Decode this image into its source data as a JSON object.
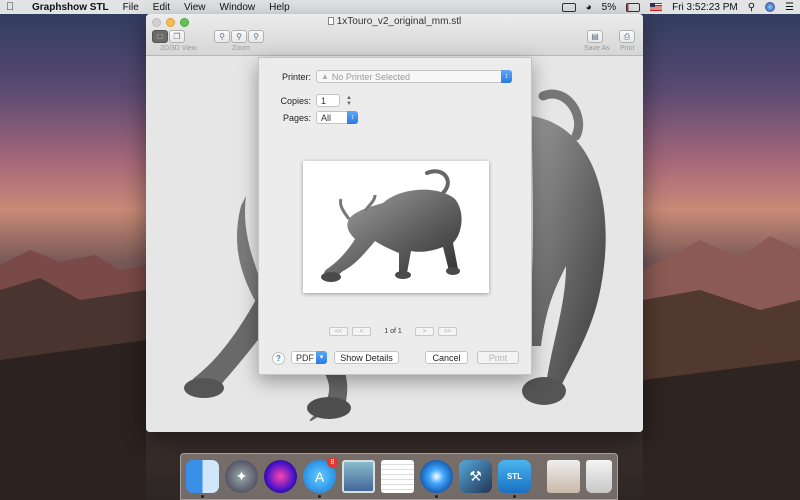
{
  "menubar": {
    "app_name": "Graphshow STL",
    "menus": [
      "File",
      "Edit",
      "View",
      "Window",
      "Help"
    ],
    "battery_percent": "5%",
    "clock": "Fri 3:52:23 PM"
  },
  "window": {
    "title": "1xTouro_v2_original_mm.stl",
    "toolbar": {
      "view_label": "2D/3D View",
      "zoom_label": "Zoom",
      "save_as_label": "Save As",
      "print_label": "Print"
    }
  },
  "print_dialog": {
    "printer_label": "Printer:",
    "printer_value": "No Printer Selected",
    "copies_label": "Copies:",
    "copies_value": "1",
    "pages_label": "Pages:",
    "pages_value": "All",
    "page_indicator": "1 of 1",
    "pager_first": "<<",
    "pager_prev": "<",
    "pager_next": ">",
    "pager_last": ">>",
    "help_label": "?",
    "pdf_label": "PDF",
    "show_details_label": "Show Details",
    "cancel_label": "Cancel",
    "print_label": "Print"
  },
  "dock": {
    "app_store_badge": "8",
    "stl_label": "STL",
    "items": [
      "finder-icon",
      "launchpad-icon",
      "siri-icon",
      "app-store-icon",
      "preview-icon",
      "textedit-icon",
      "safari-icon",
      "xcode-icon",
      "graphshow-stl-icon",
      "photos-icon",
      "trash-icon"
    ]
  }
}
